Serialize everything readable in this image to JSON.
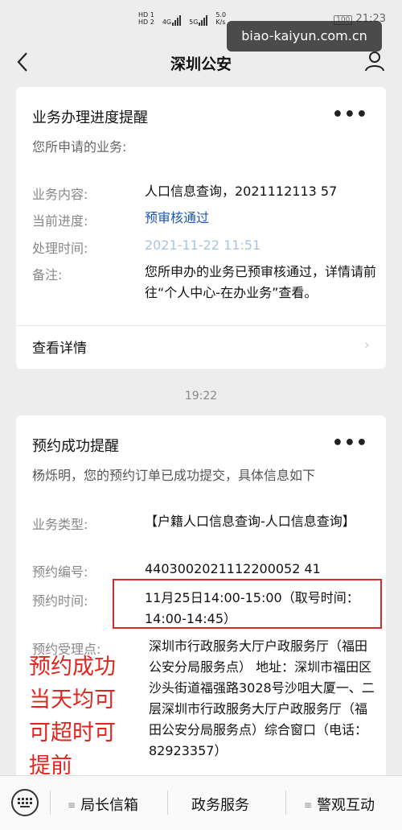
{
  "status_bar": {
    "hd1": "HD 1",
    "hd2": "HD 2",
    "net1": "4G",
    "net2": "5G",
    "speed": "5.0 K/s",
    "battery": "100",
    "time": "21:23"
  },
  "watermark": "biao-kaiyun.com.cn",
  "nav": {
    "title": "深圳公安"
  },
  "card1": {
    "title": "业务办理进度提醒",
    "subtitle": "您所申请的业务:",
    "rows": [
      {
        "label": "业务内容:",
        "value": "人口信息查询，2021112113 57"
      },
      {
        "label": "当前进度:",
        "value": "预审核通过"
      },
      {
        "label": "处理时间:",
        "value": "2021-11-22 11:51"
      },
      {
        "label": "备注:",
        "value": "您所申办的业务已预审核通过，详情请前往“个人中心-在办业务”查看。"
      }
    ],
    "detail_link": "查看详情"
  },
  "timestamp": "19:22",
  "card2": {
    "title": "预约成功提醒",
    "subtitle": "杨烁明，您的预约订单已成功提交，具体信息如下",
    "rows": [
      {
        "label": "业务类型:",
        "value": "【户籍人口信息查询-人口信息查询】"
      },
      {
        "label": "预约编号:",
        "value": "4403002021112200052 41"
      },
      {
        "label": "预约时间:",
        "value": "11月25日14:00-15:00（取号时间：14:00-14:45）"
      },
      {
        "label": "预约受理点:",
        "value": "深圳市行政服务大厅户政服务厅（福田公安分局服务点） 地址：深圳市福田区沙头街道福强路3028号沙咀大厦一、二层深圳市行政服务大厅户政服务厅（福田公安分局服务点）综合窗口（电话：82923357）"
      }
    ]
  },
  "annotation": "预约成功当天均可可超时可提前",
  "tabbar": {
    "tabs": [
      "局长信箱",
      "政务服务",
      "警观互动"
    ]
  },
  "colors": {
    "accent_blue": "#1a55b6",
    "annotation_red": "#e0261f"
  }
}
